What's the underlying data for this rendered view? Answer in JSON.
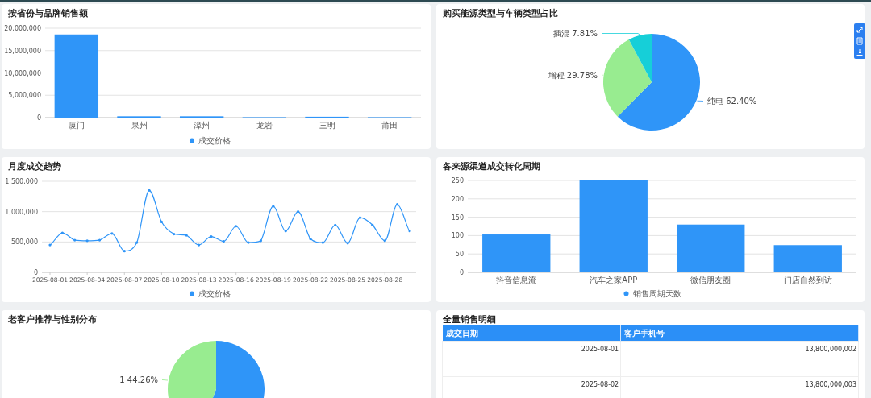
{
  "cards": [
    {
      "title": "按省份与品牌销售额",
      "chart_data": {
        "type": "bar",
        "categories": [
          "厦门",
          "泉州",
          "漳州",
          "龙岩",
          "三明",
          "莆田"
        ],
        "series": [
          {
            "name": "成交价格",
            "color": "#2f95f8",
            "values": [
              18600000,
              300000,
              300000,
              100000,
              200000,
              100000
            ]
          }
        ],
        "grid": true,
        "ylim": [
          0,
          20000000
        ],
        "yticks": [
          {
            "value": 0,
            "label": "0"
          },
          {
            "value": 5000000,
            "label": "5,000,000"
          },
          {
            "value": 10000000,
            "label": "10,000,000"
          },
          {
            "value": 15000000,
            "label": "15,000,000"
          },
          {
            "value": 20000000,
            "label": "20,000,000"
          }
        ]
      }
    },
    {
      "title": "购买能源类型与车辆类型占比",
      "toolbar": true,
      "chart_data": {
        "type": "pie",
        "categories": [
          "纯电",
          "增程",
          "插混"
        ],
        "values": [
          62.4,
          29.78,
          7.81
        ],
        "value_labels": [
          "62.40%",
          "29.78%",
          "7.81%"
        ]
      }
    },
    {
      "title": "月度成交趋势",
      "chart_data": {
        "type": "line",
        "categories": [
          "2025-08-01",
          null,
          null,
          "2025-08-04",
          null,
          null,
          "2025-08-07",
          null,
          null,
          "2025-08-10",
          null,
          null,
          "2025-08-13",
          null,
          null,
          "2025-08-16",
          null,
          null,
          "2025-08-19",
          null,
          null,
          "2025-08-22",
          null,
          null,
          "2025-08-25",
          null,
          null,
          "2025-08-28",
          null,
          null
        ],
        "series": [
          {
            "name": "成交价格",
            "color": "#2f95f8",
            "values": [
              450000,
              650000,
              530000,
              520000,
              530000,
              640000,
              350000,
              490000,
              1350000,
              830000,
              630000,
              610000,
              450000,
              590000,
              510000,
              760000,
              490000,
              520000,
              1090000,
              680000,
              1000000,
              550000,
              490000,
              780000,
              480000,
              900000,
              780000,
              520000,
              1120000,
              680000
            ]
          }
        ],
        "grid": true,
        "ylim": [
          0,
          1500000
        ],
        "yticks": [
          {
            "value": 0,
            "label": "0"
          },
          {
            "value": 500000,
            "label": "500,000"
          },
          {
            "value": 1000000,
            "label": "1,000,000"
          },
          {
            "value": 1500000,
            "label": "1,500,000"
          }
        ]
      }
    },
    {
      "title": "各来源渠道成交转化周期",
      "chart_data": {
        "type": "bar",
        "categories": [
          "抖音信息流",
          "汽车之家APP",
          "微信朋友圈",
          "门店自然到访"
        ],
        "series": [
          {
            "name": "销售周期天数",
            "color": "#2f95f8",
            "values": [
              103,
              250,
              130,
              74
            ]
          }
        ],
        "grid": true,
        "ylim": [
          0,
          250
        ],
        "yticks": [
          0,
          50,
          100,
          150,
          200,
          250
        ]
      }
    },
    {
      "title": "老客户推荐与性别分布",
      "chart_data": {
        "type": "pie",
        "categories": [
          null,
          "1"
        ],
        "values": [
          55.74,
          44.26
        ],
        "value_labels": [
          null,
          "44.26%"
        ]
      }
    },
    {
      "title": "全量销售明细",
      "table": {
        "columns": [
          "成交日期",
          "客户手机号"
        ],
        "rows": [
          [
            "2025-08-01",
            "13,800,000,002"
          ],
          [
            "2025-08-02",
            "13,800,000,003"
          ]
        ]
      }
    }
  ]
}
